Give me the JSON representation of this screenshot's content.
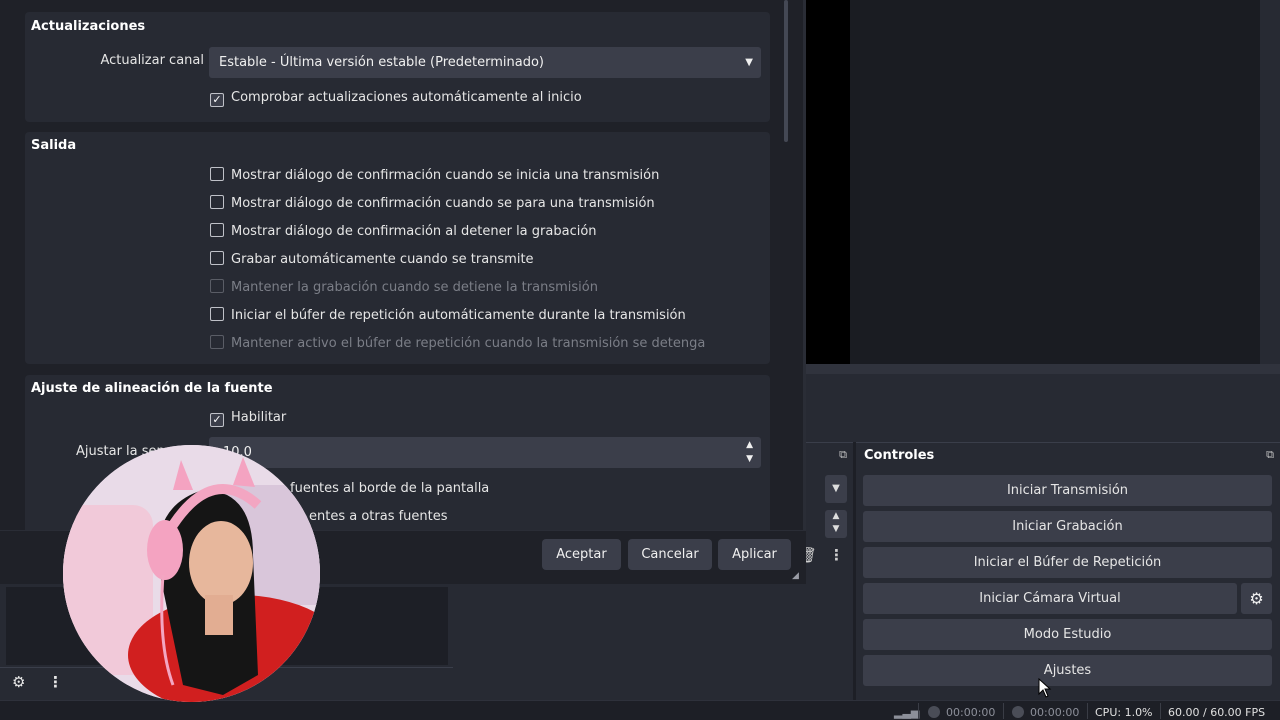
{
  "dialog": {
    "updates": {
      "title": "Actualizaciones",
      "channel_label": "Actualizar canal",
      "channel_value": "Estable - Última versión estable (Predeterminado)",
      "auto_check_label": "Comprobar actualizaciones automáticamente al inicio",
      "auto_check_checked": true
    },
    "output": {
      "title": "Salida",
      "options": [
        {
          "label": "Mostrar diálogo de confirmación cuando se inicia una transmisión",
          "checked": false,
          "enabled": true
        },
        {
          "label": "Mostrar diálogo de confirmación cuando se para una transmisión",
          "checked": false,
          "enabled": true
        },
        {
          "label": "Mostrar diálogo de confirmación al detener la grabación",
          "checked": false,
          "enabled": true
        },
        {
          "label": "Grabar automáticamente cuando se transmite",
          "checked": false,
          "enabled": true
        },
        {
          "label": "Mantener la grabación cuando se detiene la transmisión",
          "checked": false,
          "enabled": false
        },
        {
          "label": "Iniciar el búfer de repetición automáticamente durante la transmisión",
          "checked": false,
          "enabled": true
        },
        {
          "label": "Mantener activo el búfer de repetición cuando la transmisión se detenga",
          "checked": false,
          "enabled": false
        }
      ]
    },
    "snapping": {
      "title": "Ajuste de alineación de la fuente",
      "enable_label": "Habilitar",
      "enable_checked": true,
      "sensitivity_label": "Ajustar la sen",
      "sensitivity_value": "10.0",
      "screen_edge_label": "fuentes al borde de la pantalla",
      "other_sources_label": "entes a otras fuentes"
    },
    "buttons": {
      "accept": "Aceptar",
      "cancel": "Cancelar",
      "apply": "Aplicar"
    }
  },
  "controls": {
    "title": "Controles",
    "start_streaming": "Iniciar Transmisión",
    "start_recording": "Iniciar Grabación",
    "start_replay_buffer": "Iniciar el Búfer de Repetición",
    "start_virtual_camera": "Iniciar Cámara Virtual",
    "studio_mode": "Modo Estudio",
    "settings": "Ajustes"
  },
  "statusbar": {
    "stream_time": "00:00:00",
    "record_time": "00:00:00",
    "cpu": "CPU: 1.0%",
    "fps": "60.00 / 60.00 FPS"
  },
  "colors": {
    "window_bg": "#1d1f26",
    "panel_bg": "#272a33",
    "button_bg": "#3b3e4a",
    "text": "#e6e6e6"
  }
}
